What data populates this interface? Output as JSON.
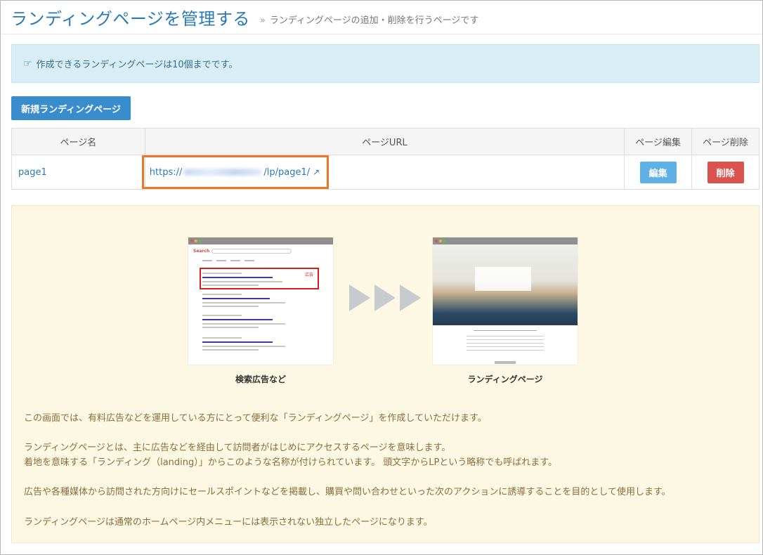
{
  "header": {
    "title": "ランディングページを管理する",
    "subtitle_sep": "»",
    "subtitle": "ランディングページの追加・削除を行うページです"
  },
  "notice": {
    "icon": "hand-pointer-icon",
    "text": "作成できるランディングページは10個までです。"
  },
  "actions": {
    "new_label": "新規ランディングページ"
  },
  "table": {
    "headers": {
      "name": "ページ名",
      "url": "ページURL",
      "edit": "ページ編集",
      "delete": "ページ削除"
    },
    "rows": [
      {
        "name": "page1",
        "url_prefix": "https://",
        "url_suffix": "/lp/page1/",
        "edit_label": "編集",
        "delete_label": "削除"
      }
    ]
  },
  "info": {
    "caption_search": "検索広告など",
    "caption_lp": "ランディングページ",
    "serp_logo": "Search",
    "ad_label": "広告",
    "paragraphs": [
      "この画面では、有料広告などを運用している方にとって便利な「ランディングページ」を作成していただけます。",
      "ランディングページとは、主に広告などを経由して訪問者がはじめにアクセスするページを意味します。",
      "着地を意味する「ランディング（landing）」からこのような名称が付けられています。 頭文字からLPという略称でも呼ばれます。",
      "広告や各種媒体から訪問された方向けにセールスポイントなどを掲載し、購買や問い合わせといった次のアクションに誘導することを目的として使用します。",
      "ランディングページは通常のホームページ内メニューには表示されない独立したページになります。"
    ]
  },
  "colors": {
    "accent": "#2a7ab8",
    "primary_button": "#3a8dcc",
    "edit_button": "#5fb0e4",
    "delete_button": "#d9534f",
    "highlight_border": "#e8792a",
    "info_bg": "#fcf8e3",
    "notice_bg": "#d9edf7"
  }
}
